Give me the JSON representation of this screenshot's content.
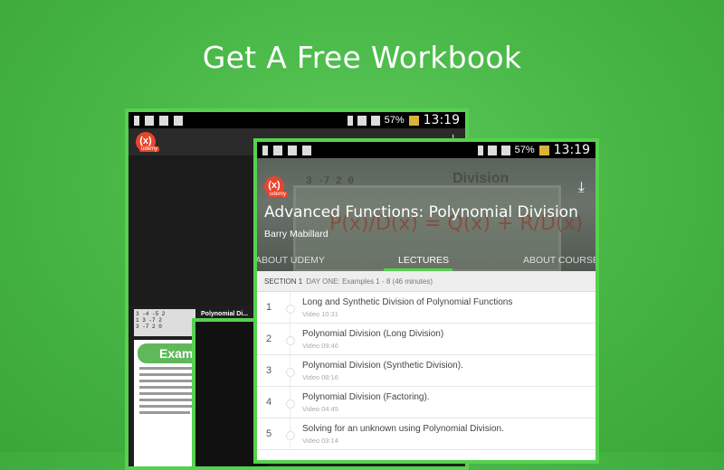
{
  "headline": "Get A Free Workbook",
  "status_bar": {
    "battery_percent": "57%",
    "time": "13:19"
  },
  "app": {
    "logo_text": "(x)",
    "logo_sub": "udemy"
  },
  "back_screen": {
    "thumb_rows": [
      "3 -4 -5 2",
      "1 3 -7 2",
      "3 -7 2 0"
    ],
    "thumb_title": "Polynomial Di...",
    "page_banner": "Exam"
  },
  "course": {
    "title": "Advanced Functions: Polynomial Division",
    "author": "Barry Mabillard",
    "header_image_text": {
      "division": "Division",
      "formula": "P(x)/D(x) = Q(x) + R/D(x)",
      "numbers": "3  -7  2  0"
    }
  },
  "tabs": [
    {
      "label": "ABOUT UDEMY"
    },
    {
      "label": "LECTURES"
    },
    {
      "label": "ABOUT COURSE"
    }
  ],
  "section": {
    "label": "SECTION 1",
    "title": "DAY ONE: Examples 1 - 8 (46 minutes)"
  },
  "lectures": [
    {
      "num": "1",
      "title": "Long and Synthetic Division of Polynomial Functions",
      "meta": "Video 10:31"
    },
    {
      "num": "2",
      "title": "Polynomial Division (Long Division)",
      "meta": "Video 09:46"
    },
    {
      "num": "3",
      "title": "Polynomial Division (Synthetic Division).",
      "meta": "Video 08:16"
    },
    {
      "num": "4",
      "title": "Polynomial Division (Factoring).",
      "meta": "Video 04:45"
    },
    {
      "num": "5",
      "title": "Solving for an unknown using Polynomial Division.",
      "meta": "Video 03:14"
    }
  ]
}
